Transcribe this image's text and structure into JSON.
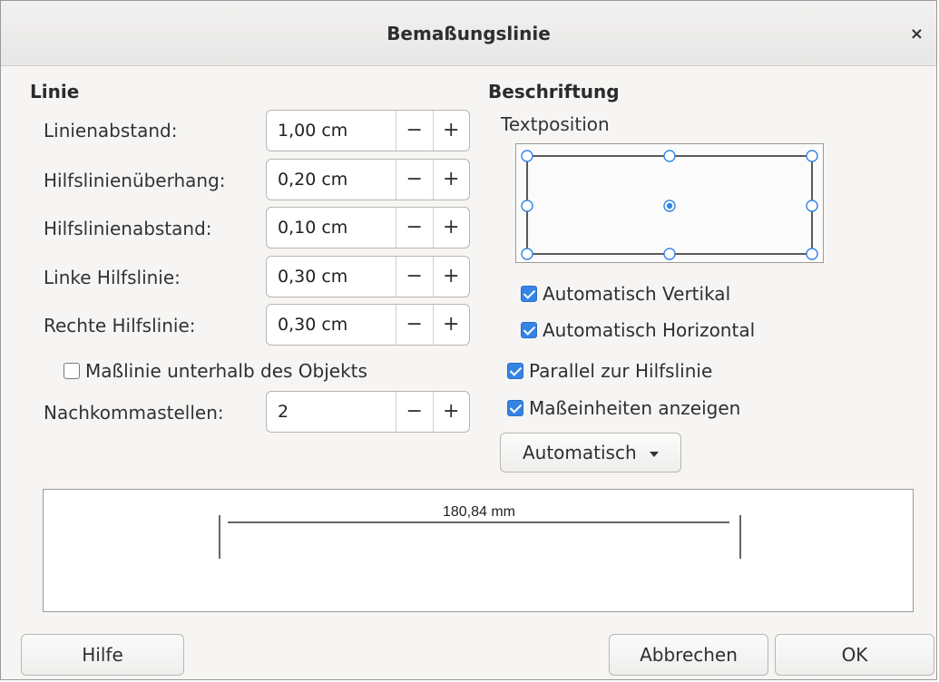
{
  "window": {
    "title": "Bemaßungslinie",
    "close_glyph": "×"
  },
  "linie": {
    "heading": "Linie",
    "fields": [
      {
        "label": "Linienabstand:",
        "value": "1,00 cm"
      },
      {
        "label": "Hilfslinienüberhang:",
        "value": "0,20 cm"
      },
      {
        "label": "Hilfslinienabstand:",
        "value": "0,10 cm"
      },
      {
        "label": "Linke Hilfslinie:",
        "value": "0,30 cm"
      },
      {
        "label": "Rechte Hilfslinie:",
        "value": "0,30 cm"
      }
    ],
    "below_check": {
      "label": "Maßlinie unterhalb des Objekts",
      "checked": false
    },
    "decimals": {
      "label": "Nachkommastellen:",
      "value": "2"
    },
    "minus": "−",
    "plus": "+"
  },
  "beschriftung": {
    "heading": "Beschriftung",
    "textposition_label": "Textposition",
    "checks": [
      {
        "label": "Automatisch Vertikal",
        "checked": true
      },
      {
        "label": "Automatisch Horizontal",
        "checked": true
      },
      {
        "label": "Parallel zur Hilfslinie",
        "checked": true
      },
      {
        "label": "Maßeinheiten anzeigen",
        "checked": true
      }
    ],
    "unit_dropdown": {
      "value": "Automatisch",
      "icon": "chevron-down-icon"
    }
  },
  "preview": {
    "measure_text": "180,84 mm"
  },
  "footer": {
    "help": "Hilfe",
    "cancel": "Abbrechen",
    "ok": "OK"
  },
  "colors": {
    "accent": "#3584e4",
    "window_bg": "#f6f5f4"
  }
}
